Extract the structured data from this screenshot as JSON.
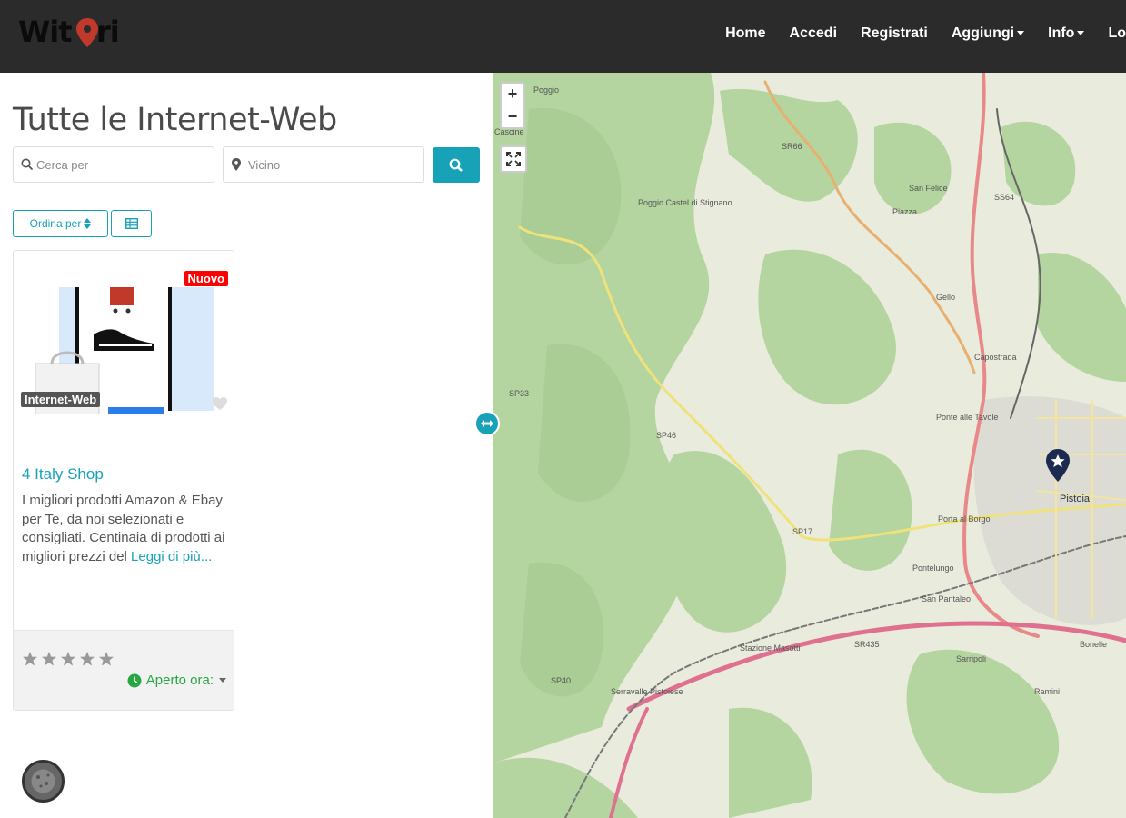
{
  "brand": {
    "logo_text": "Witori"
  },
  "nav": {
    "items": [
      {
        "label": "Home"
      },
      {
        "label": "Accedi"
      },
      {
        "label": "Registrati"
      },
      {
        "label": "Aggiungi"
      },
      {
        "label": "Info"
      },
      {
        "label": "Lo"
      }
    ]
  },
  "page": {
    "title": "Tutte le Internet-Web"
  },
  "search": {
    "what_placeholder": "Cerca per",
    "where_placeholder": "Vicino"
  },
  "controls": {
    "sort_label": "Ordina per"
  },
  "listing": {
    "badge_new": "Nuovo",
    "category": "Internet-Web",
    "name": "4 Italy Shop",
    "description": "I migliori prodotti Amazon & Ebay per Te, da noi selezionati e consigliati. Centinaia di prodotti ai migliori prezzi del",
    "read_more": "Leggi di più...",
    "rating": 0,
    "status": "Aperto ora:"
  },
  "map": {
    "labels": [
      "Poggio",
      "Cascine",
      "Poggio Castel di Stignano",
      "SR66",
      "San Felice",
      "SS64",
      "Piazza",
      "Gello",
      "Capostrada",
      "SP33",
      "SP46",
      "SP17",
      "Pistoia",
      "Ponte alle Tavole",
      "Porta al Borgo",
      "Pontelungo",
      "San Pantaleo",
      "Stazione Masotti",
      "SR435",
      "SP40",
      "Serravalle Pistoiese",
      "Sarripoli",
      "Bonelle",
      "Ramini"
    ]
  }
}
